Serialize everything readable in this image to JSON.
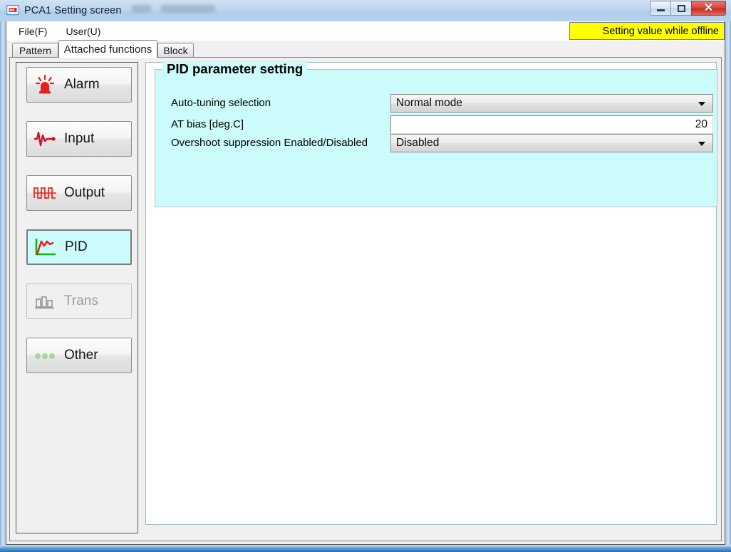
{
  "window": {
    "title": "PCA1 Setting screen",
    "app_icon": "monitor-icon",
    "buttons": {
      "minimize": "minimize-icon",
      "maximize": "maximize-icon",
      "close": "✕"
    }
  },
  "menu": {
    "items": [
      {
        "label": "File(F)",
        "name": "menu-file"
      },
      {
        "label": "User(U)",
        "name": "menu-user"
      }
    ],
    "offline_banner": "Setting value while offline",
    "offline_banner_bg": "#ffff00"
  },
  "tabs": [
    {
      "label": "Pattern",
      "active": false
    },
    {
      "label": "Attached functions",
      "active": true
    },
    {
      "label": "Block",
      "active": false
    }
  ],
  "sidebar": {
    "items": [
      {
        "label": "Alarm",
        "icon": "alarm-beacon-icon",
        "state": "normal"
      },
      {
        "label": "Input",
        "icon": "waveform-icon",
        "state": "normal"
      },
      {
        "label": "Output",
        "icon": "square-wave-icon",
        "state": "normal"
      },
      {
        "label": "PID",
        "icon": "pid-curve-icon",
        "state": "selected"
      },
      {
        "label": "Trans",
        "icon": "bar-chart-icon",
        "state": "disabled"
      },
      {
        "label": "Other",
        "icon": "three-dots-icon",
        "state": "normal"
      }
    ],
    "selected_bg": "#ccfbfb"
  },
  "main": {
    "groupbox": {
      "title": "PID parameter setting",
      "bg": "#ccfbfb",
      "rows": [
        {
          "label": "Auto-tuning selection",
          "control": "dropdown",
          "value": "Normal mode"
        },
        {
          "label": "AT bias [deg.C]",
          "control": "textbox",
          "value": "20"
        },
        {
          "label": "Overshoot suppression Enabled/Disabled",
          "control": "dropdown",
          "value": "Disabled"
        }
      ]
    }
  }
}
